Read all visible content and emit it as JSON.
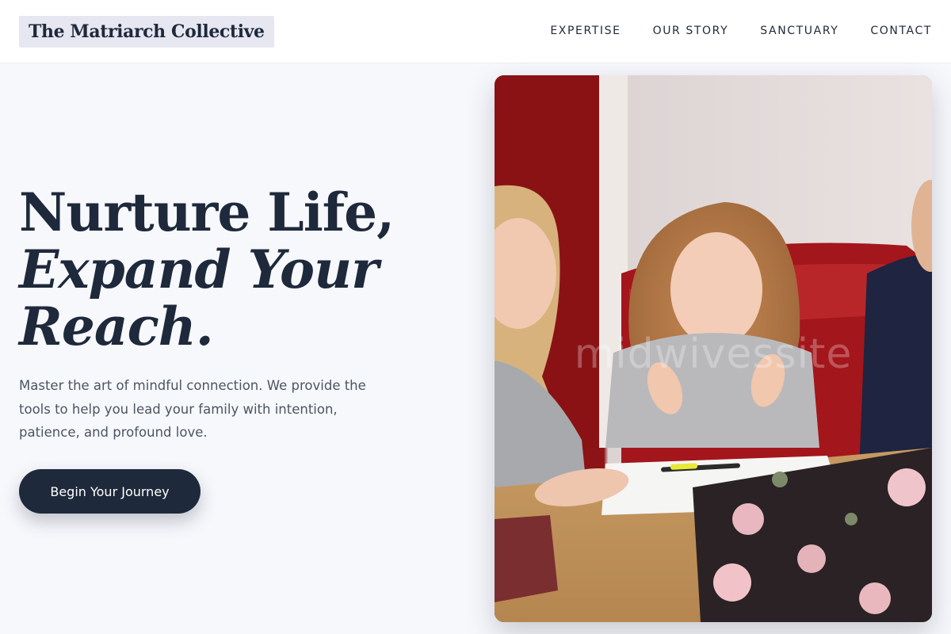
{
  "header": {
    "logo": "The Matriarch Collective",
    "nav": [
      {
        "label": "EXPERTISE"
      },
      {
        "label": "OUR STORY"
      },
      {
        "label": "SANCTUARY"
      },
      {
        "label": "CONTACT"
      }
    ]
  },
  "hero": {
    "headline_line1": "Nurture Life,",
    "headline_line2": "Expand Your",
    "headline_line3": "Reach.",
    "description": "Master the art of mindful connection. We provide the tools to help you lead your family with intention, patience, and profound love.",
    "cta_label": "Begin Your Journey",
    "image": {
      "icon": "family-learning-photo",
      "watermark": "midwivessite"
    }
  },
  "colors": {
    "navy": "#1e293b",
    "background": "#f7f8fc",
    "logo_bg": "#e7e7f1",
    "body_text": "#4b5563"
  }
}
